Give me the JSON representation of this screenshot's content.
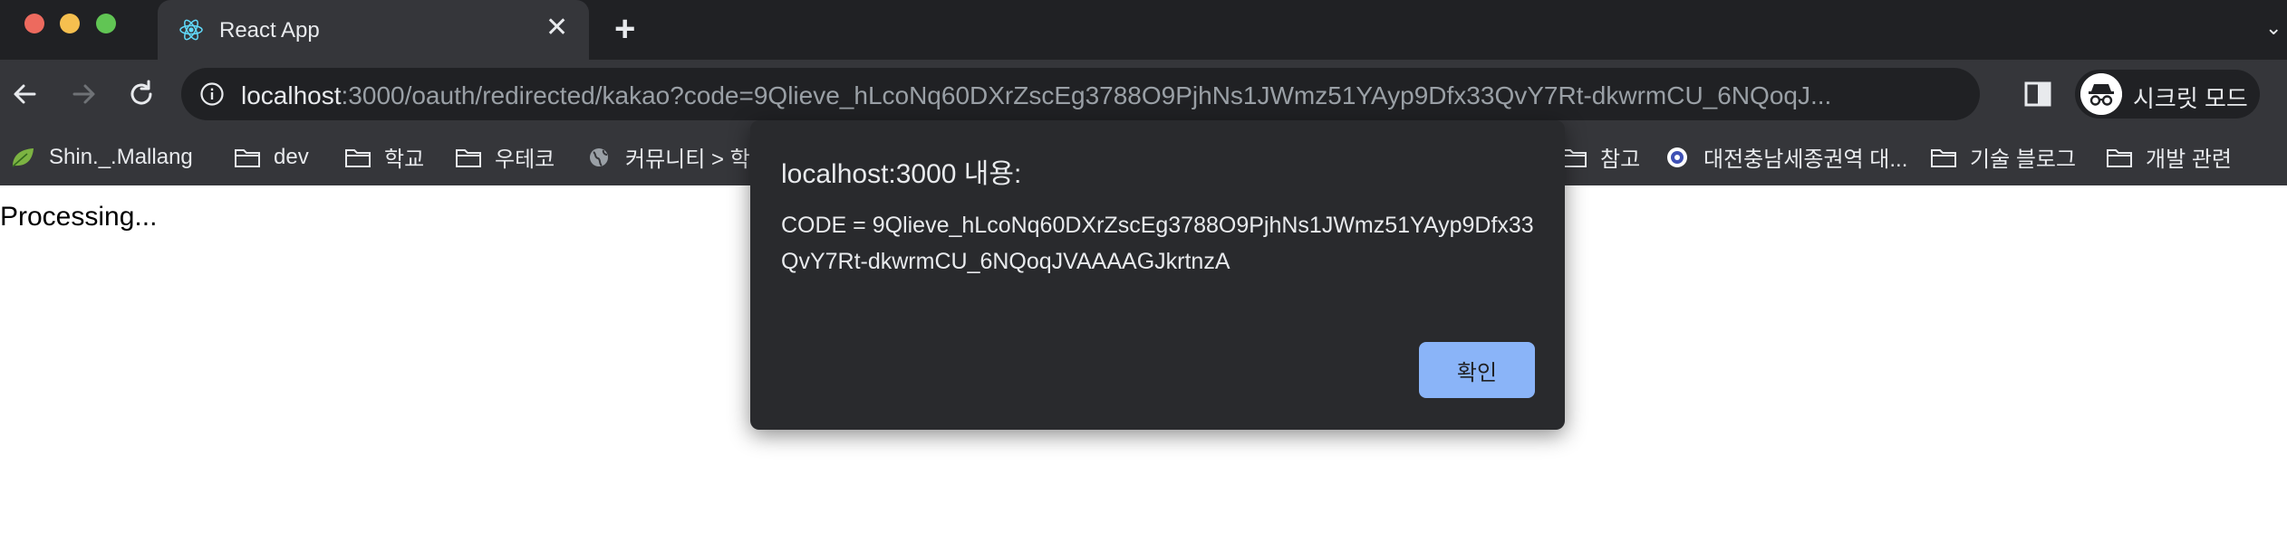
{
  "tab": {
    "title": "React App",
    "close_glyph": "✕",
    "icon": "react-logo-icon"
  },
  "tabstrip": {
    "new_tab_glyph": "+",
    "more_glyph": "⌄"
  },
  "toolbar": {
    "url_host": "localhost",
    "url_rest": ":3000/oauth/redirected/kakao?code=9Qlieve_hLcoNq60DXrZscEg3788O9PjhNs1JWmz51YAyp9Dfx33QvY7Rt-dkwrmCU_6NQoqJ...",
    "incognito_label": "시크릿 모드"
  },
  "bookmarks": [
    {
      "label": "Shin._.Mallang",
      "icon": "leaf-icon"
    },
    {
      "label": "dev",
      "icon": "folder-icon"
    },
    {
      "label": "학교",
      "icon": "folder-icon"
    },
    {
      "label": "우테코",
      "icon": "folder-icon"
    },
    {
      "label": "커뮤니티 > 학",
      "icon": "globe-icon"
    },
    {
      "label": "참고",
      "icon": "folder-icon"
    },
    {
      "label": "대전충남세종권역 대...",
      "icon": "emblem-icon"
    },
    {
      "label": "기술 블로그",
      "icon": "folder-icon"
    },
    {
      "label": "개발 관련",
      "icon": "folder-icon"
    }
  ],
  "page": {
    "text": "Processing..."
  },
  "dialog": {
    "title": "localhost:3000 내용:",
    "message": "CODE = 9Qlieve_hLcoNq60DXrZscEg3788O9PjhNs1JWmz51YAyp9Dfx33QvY7Rt-dkwrmCU_6NQoqJVAAAAGJkrtnzA",
    "ok_label": "확인"
  },
  "colors": {
    "frame": "#202124",
    "toolbar": "#35363a",
    "dialog_bg": "#292a2d",
    "button_accent": "#8ab4f8"
  }
}
